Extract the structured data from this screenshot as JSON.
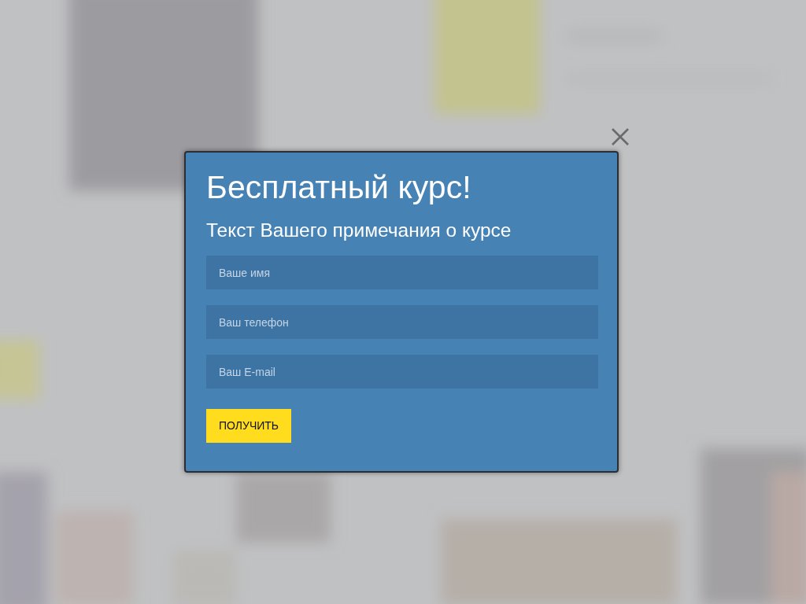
{
  "modal": {
    "title": "Бесплатный курс!",
    "subtitle": "Текст Вашего примечания о курсе",
    "fields": [
      {
        "placeholder": "Ваше имя"
      },
      {
        "placeholder": "Ваш телефон"
      },
      {
        "placeholder": "Ваш E-mail"
      }
    ],
    "submit_button": "ПОЛУЧИТЬ"
  }
}
